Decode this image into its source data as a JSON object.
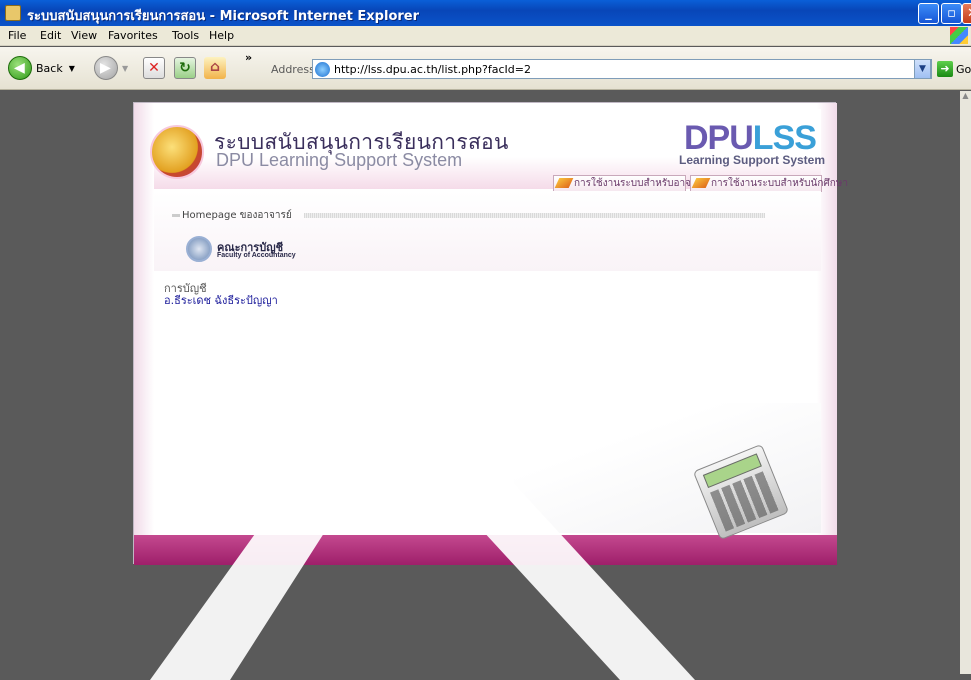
{
  "window": {
    "title": "ระบบสนับสนุนการเรียนการสอน - Microsoft Internet Explorer",
    "controls": {
      "minimize": "_",
      "maximize": "▫",
      "close": "✕"
    }
  },
  "menu": [
    "File",
    "Edit",
    "View",
    "Favorites",
    "Tools",
    "Help"
  ],
  "toolbar": {
    "back_label": "Back",
    "more": "»",
    "address_label": "Address",
    "url": "http://lss.dpu.ac.th/list.php?facId=2",
    "go_label": "Go"
  },
  "site": {
    "title_th": "ระบบสนับสนุนการเรียนการสอน",
    "title_en": "DPU Learning Support System",
    "brand_dpu": "DPU",
    "brand_lss": "LSS",
    "brand_sub": "Learning Support System",
    "tabs": [
      "การใช้งานระบบสำหรับอาจารย์",
      "การใช้งานระบบสำหรับนักศึกษา"
    ],
    "section_title": "Homepage ของอาจารย์",
    "faculty_th": "คณะการบัญชี",
    "faculty_en": "Faculty of Accountancy",
    "department": "การบัญชี",
    "teacher": "อ.ธีระเดช ฉังธีระปัญญา"
  },
  "icons": {
    "app": "ie-page-icon",
    "back": "back-arrow-icon",
    "forward": "forward-arrow-icon",
    "stop": "stop-icon",
    "refresh": "refresh-icon",
    "home": "home-icon",
    "go": "go-arrow-icon"
  },
  "colors": {
    "title_bar": "#0a53c9",
    "brand_dpu": "#6a5ab0",
    "brand_lss": "#3aa0d8",
    "page_accent": "#b03a7e",
    "viewport": "#5a5a5a"
  }
}
